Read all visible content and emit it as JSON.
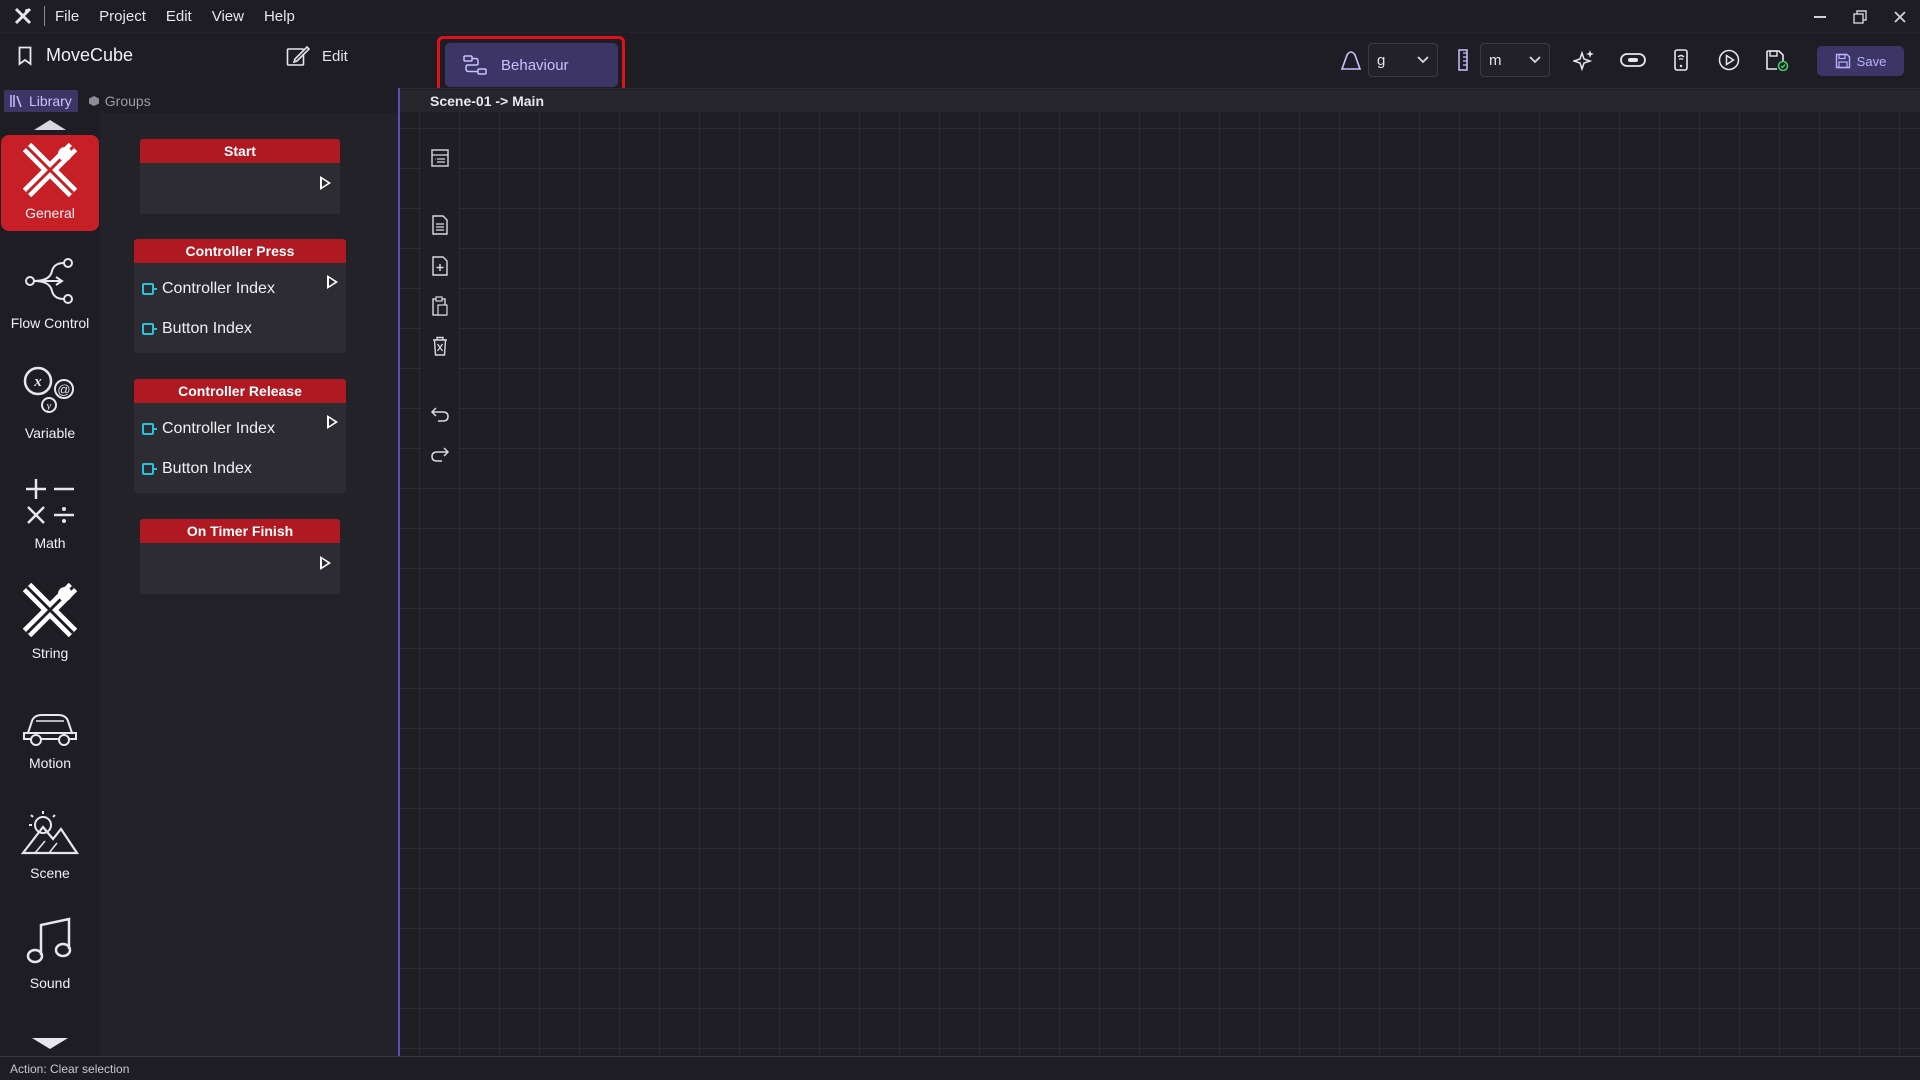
{
  "menubar": {
    "items": [
      "File",
      "Project",
      "Edit",
      "View",
      "Help"
    ]
  },
  "toolbar": {
    "project_name": "MoveCube",
    "edit_label": "Edit",
    "behaviour_label": "Behaviour",
    "gravity_value": "g",
    "units_value": "m",
    "save_label": "Save"
  },
  "library_tabs": {
    "library": "Library",
    "groups": "Groups"
  },
  "categories": [
    {
      "label": "General",
      "icon": "general-x-icon",
      "active": true
    },
    {
      "label": "Flow Control",
      "icon": "flow-control-icon",
      "active": false
    },
    {
      "label": "Variable",
      "icon": "variable-icon",
      "active": false
    },
    {
      "label": "Math",
      "icon": "math-icon",
      "active": false
    },
    {
      "label": "String",
      "icon": "string-icon",
      "active": false
    },
    {
      "label": "Motion",
      "icon": "car-icon",
      "active": false
    },
    {
      "label": "Scene",
      "icon": "scene-icon",
      "active": false
    },
    {
      "label": "Sound",
      "icon": "music-note-icon",
      "active": false
    }
  ],
  "blocks": [
    {
      "title": "Start",
      "inputs": []
    },
    {
      "title": "Controller Press",
      "inputs": [
        "Controller Index",
        "Button Index"
      ]
    },
    {
      "title": "Controller Release",
      "inputs": [
        "Controller Index",
        "Button Index"
      ]
    },
    {
      "title": "On Timer Finish",
      "inputs": []
    }
  ],
  "canvas": {
    "breadcrumb": "Scene-01 -> Main"
  },
  "status": {
    "text": "Action: Clear selection"
  },
  "colors": {
    "accent": "#3c3566",
    "block_header": "#b01822",
    "active_category": "#c61f26",
    "highlight": "#e0111a",
    "pin": "#27c4d8"
  }
}
